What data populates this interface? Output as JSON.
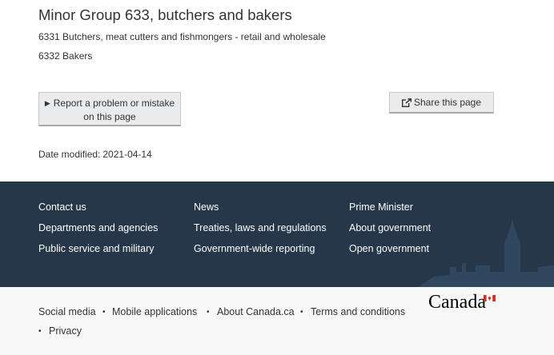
{
  "main": {
    "title": "Minor Group 633, butchers and bakers",
    "items": [
      "6331 Butchers, meat cutters and fishmongers - retail and wholesale",
      "6332 Bakers"
    ],
    "report_button": {
      "line1": "Report a problem or mistake",
      "line2": "on this page"
    },
    "share_button": "Share this page",
    "date_label": "Date modified:",
    "date_value": "2021-04-14"
  },
  "footer": {
    "col1": [
      "Contact us",
      "Departments and agencies",
      "Public service and military"
    ],
    "col2": [
      "News",
      "Treaties, laws and regulations",
      "Government-wide reporting"
    ],
    "col3": [
      "Prime Minister",
      "About government",
      "Open government"
    ]
  },
  "bottom": {
    "links": [
      "Social media",
      "Mobile applications",
      "About Canada.ca",
      "Terms and conditions",
      "Privacy"
    ],
    "wordmark": "Canada"
  },
  "colors": {
    "footer_bg": "#26374a",
    "bottom_bg": "#f8f8f8",
    "flag_red": "#d52b1e"
  },
  "icons": {
    "report_triangle": "triangle-right-icon",
    "share": "share-icon",
    "flag": "canada-flag-icon"
  }
}
